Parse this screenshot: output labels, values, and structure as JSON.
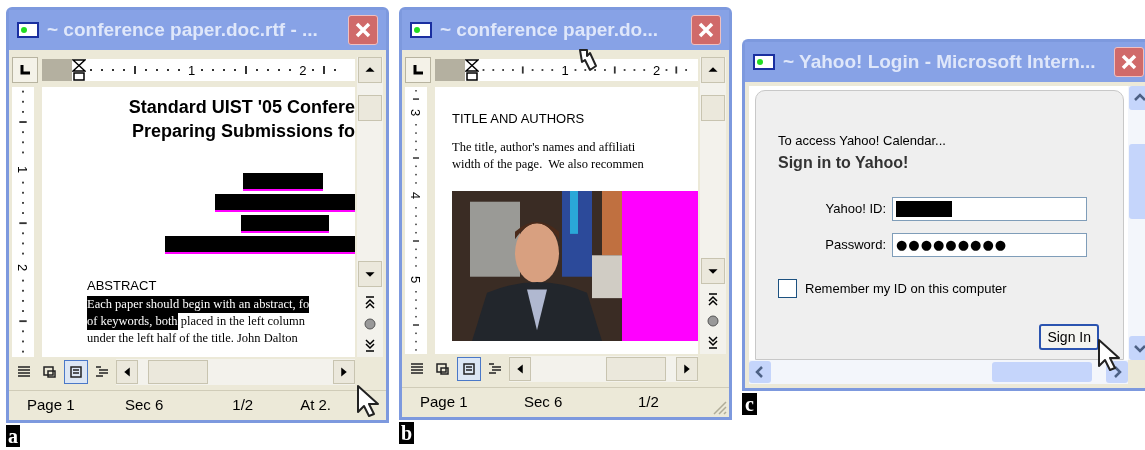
{
  "panels": [
    {
      "kind": "word",
      "label": "a",
      "title": "~ conference paper.doc.rtf - ...",
      "ruler_numbers": [
        "1",
        "2"
      ],
      "vertical_ruler_numbers": [
        "1",
        "2"
      ],
      "document": [
        {
          "kind": "title",
          "text": "Standard UIST '05 Confere"
        },
        {
          "kind": "title",
          "text": "Preparing Submissions fo"
        },
        {
          "kind": "redactions"
        },
        {
          "kind": "heading",
          "text": "ABSTRACT"
        },
        {
          "kind": "paragraph",
          "lines": [
            [
              {
                "text": "Each paper should begin with an abstract, fo",
                "selected": true
              }
            ],
            [
              {
                "text": "of keywords, both",
                "selected": true
              },
              {
                "text": " placed in the left column",
                "selected": false
              }
            ],
            [
              {
                "text": "under the left half of the title. John Dalton",
                "selected": false
              }
            ]
          ]
        }
      ],
      "status_bar": [
        "Page 1",
        "Sec 6",
        "1/2",
        "At 2."
      ]
    },
    {
      "kind": "word",
      "label": "b",
      "title": "~ conference paper.do...",
      "ruler_numbers": [
        "1",
        "2"
      ],
      "vertical_ruler_numbers": [
        "3",
        "4",
        "5"
      ],
      "document": [
        {
          "kind": "heading",
          "text": "TITLE AND AUTHORS"
        },
        {
          "kind": "paragraph",
          "lines": [
            [
              {
                "text": "The title, author's names and affiliati",
                "selected": false
              }
            ],
            [
              {
                "text": "width of the page.  We also recommen",
                "selected": false
              }
            ]
          ]
        },
        {
          "kind": "picture"
        }
      ],
      "status_bar": [
        "Page 1",
        "Sec 6",
        "1/2"
      ]
    },
    {
      "kind": "browser",
      "label": "c",
      "title": "~ Yahoo! Login - Microsoft Intern...",
      "intro": "To access Yahoo! Calendar...",
      "heading": "Sign in to Yahoo!",
      "fields": [
        {
          "label": "Yahoo! ID:",
          "kind": "redacted"
        },
        {
          "label": "Password:",
          "kind": "password",
          "value": "●●●●●●●●●"
        }
      ],
      "remember": {
        "label": "Remember my ID on this computer",
        "checked": false
      },
      "button": "Sign In"
    }
  ]
}
